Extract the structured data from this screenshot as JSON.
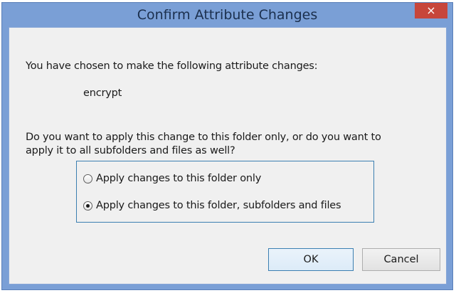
{
  "dialog": {
    "title": "Confirm Attribute Changes",
    "close_label": "×",
    "intro_text": "You have chosen to make the following attribute changes:",
    "attribute_change": "encrypt",
    "question_line1": "Do you want to apply this change to this folder only, or do you want to",
    "question_line2": "apply it to all subfolders and files as well?",
    "options": [
      {
        "label": "Apply changes to this folder only",
        "selected": false
      },
      {
        "label": "Apply changes to this folder, subfolders and files",
        "selected": true
      }
    ],
    "ok_label": "OK",
    "cancel_label": "Cancel"
  },
  "colors": {
    "frame": "#7a9fd6",
    "close_button": "#c7463b",
    "focus_border": "#3c7fb1",
    "client_background": "#f0f0f0"
  }
}
